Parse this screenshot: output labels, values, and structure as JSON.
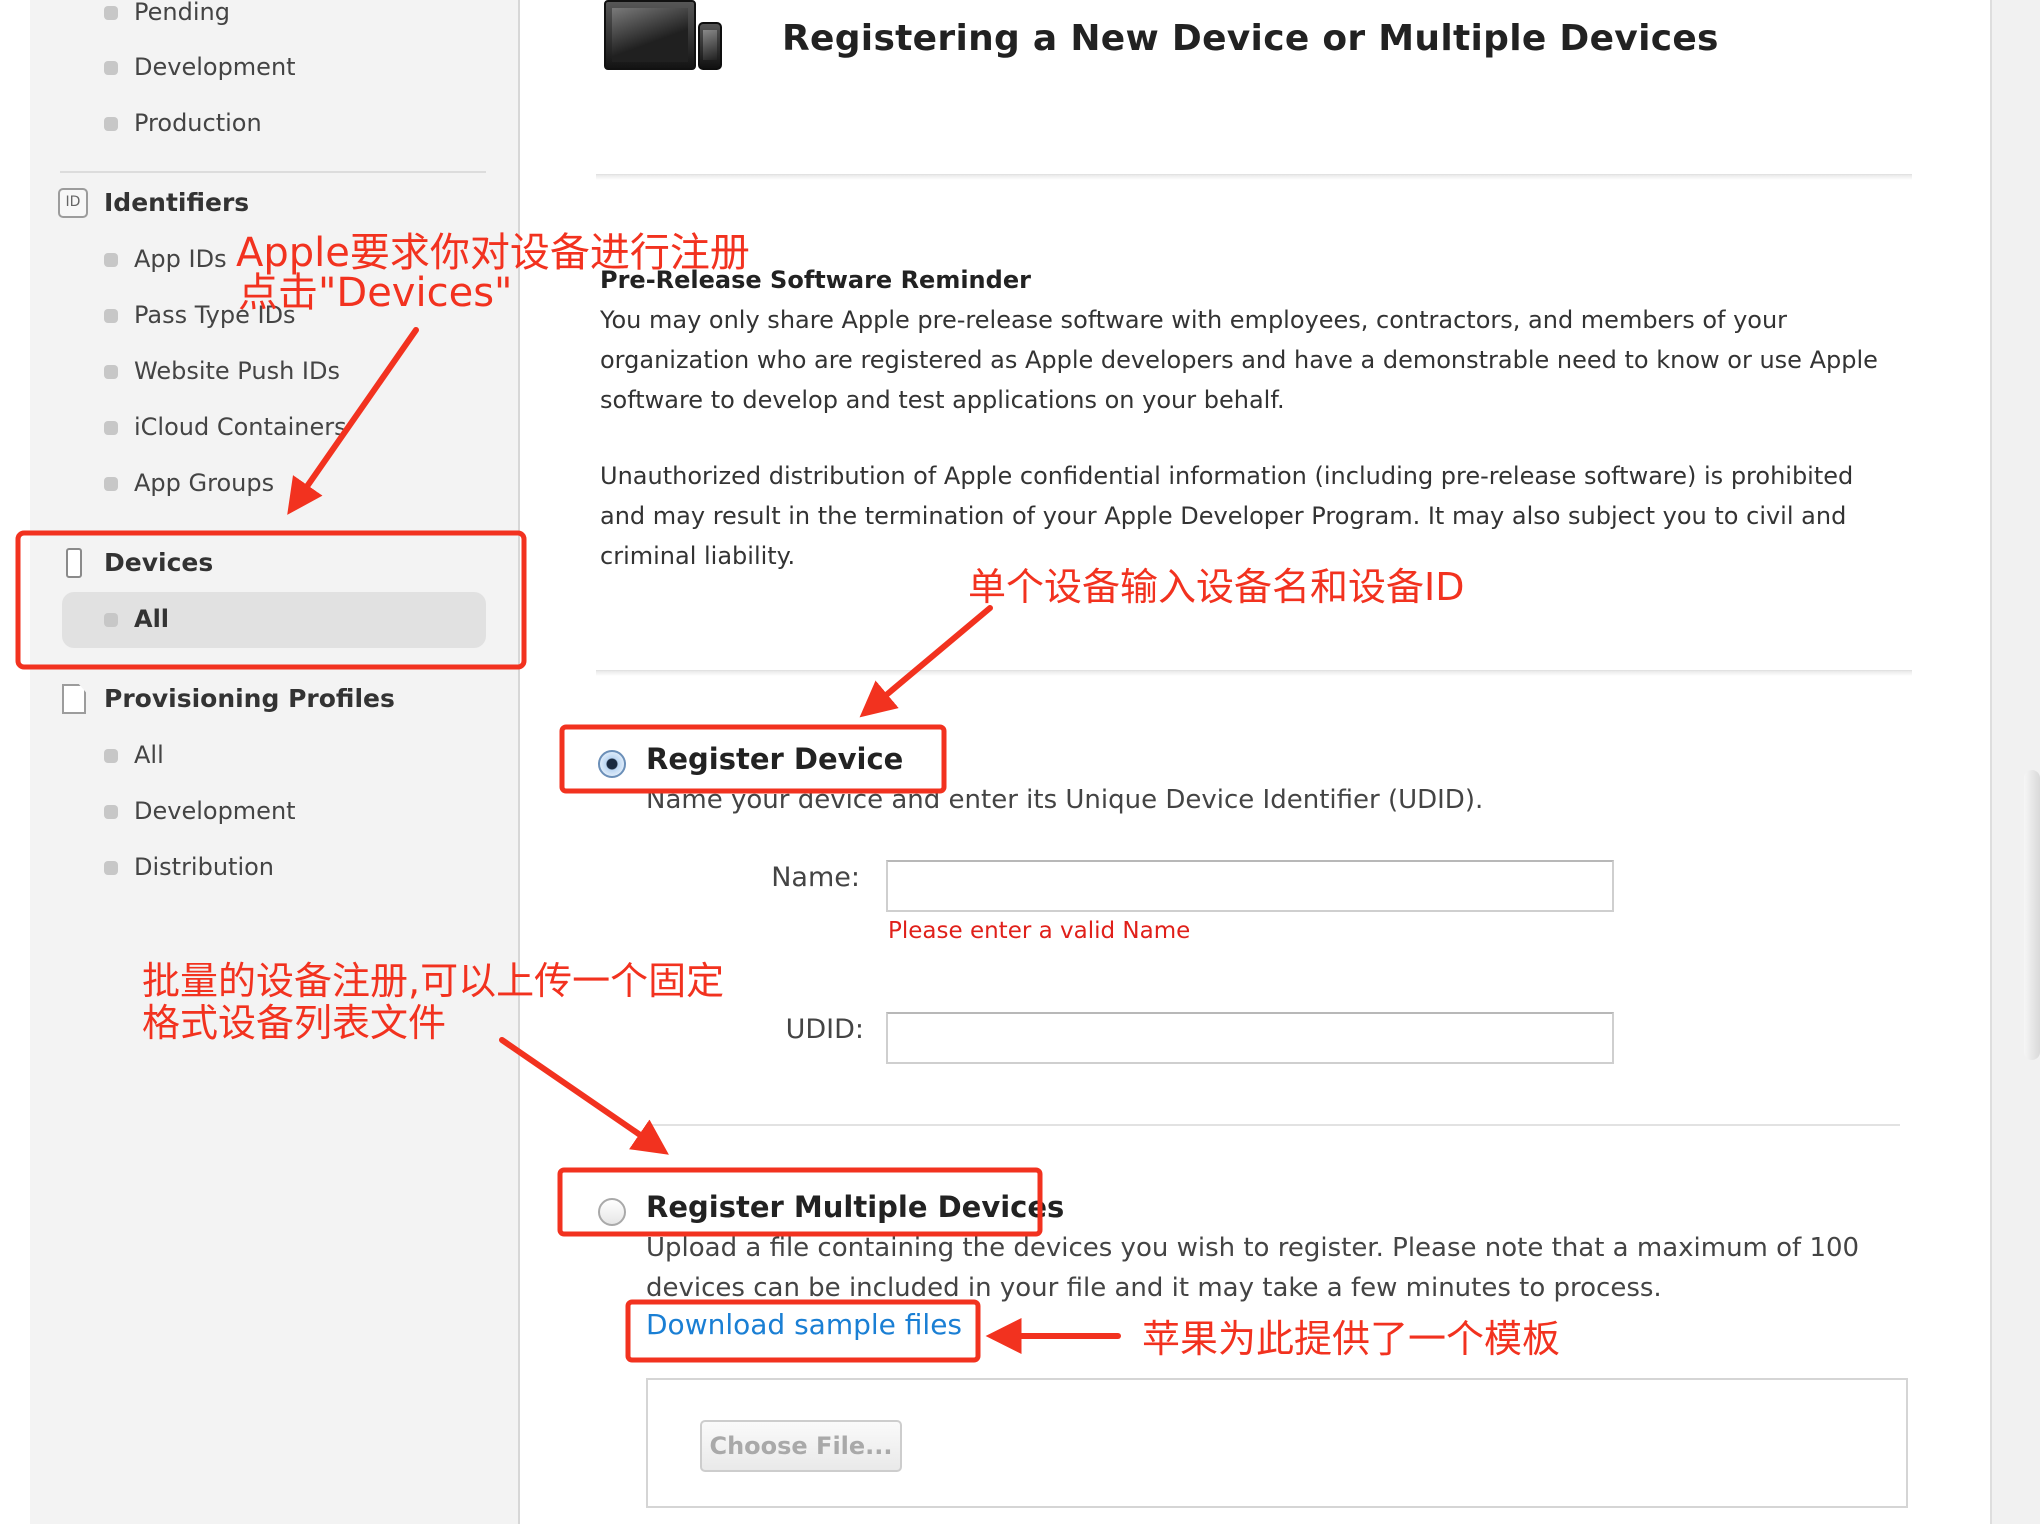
{
  "sidebar": {
    "certificates_items": [
      "Pending",
      "Development",
      "Production"
    ],
    "identifiers": {
      "icon_text": "ID",
      "heading": "Identifiers",
      "items": [
        "App IDs",
        "Pass Type IDs",
        "Website Push IDs",
        "iCloud Containers",
        "App Groups"
      ]
    },
    "devices": {
      "heading": "Devices",
      "items": [
        "All"
      ]
    },
    "provisioning": {
      "heading": "Provisioning Profiles",
      "items": [
        "All",
        "Development",
        "Distribution"
      ]
    }
  },
  "main": {
    "title": "Registering a New Device or Multiple Devices",
    "reminder": {
      "title": "Pre-Release Software Reminder",
      "paragraph1": "You may only share Apple pre-release software with employees, contractors, and members of your organization who are registered as Apple developers and have a demonstrable need to know or use Apple software to develop and test applications on your behalf.",
      "paragraph2": "Unauthorized distribution of Apple confidential information (including pre-release software) is prohibited and may result in the termination of your Apple Developer Program. It may also subject you to civil and criminal liability."
    },
    "register_device": {
      "title": "Register Device",
      "description": "Name your device and enter its Unique Device Identifier (UDID).",
      "name_label": "Name:",
      "name_value": "",
      "name_error": "Please enter a valid Name",
      "udid_label": "UDID:",
      "udid_value": ""
    },
    "register_multiple": {
      "title": "Register Multiple Devices",
      "description": "Upload a file containing the devices you wish to register. Please note that a maximum of 100 devices can be included in your file and it may take a few minutes to process.",
      "download_link": "Download sample files",
      "choose_file": "Choose File..."
    }
  },
  "annotations": {
    "devices_line1": "Apple要求你对设备进行注册",
    "devices_line2": "点击\"Devices\"",
    "single": "单个设备输入设备名和设备ID",
    "multiple_line1": "批量的设备注册,可以上传一个固定",
    "multiple_line2": "格式设备列表文件",
    "template": "苹果为此提供了一个模板"
  },
  "colors": {
    "annotation_red": "#f2321f",
    "link_blue": "#1a7fd4",
    "error_red": "#e0201a"
  }
}
